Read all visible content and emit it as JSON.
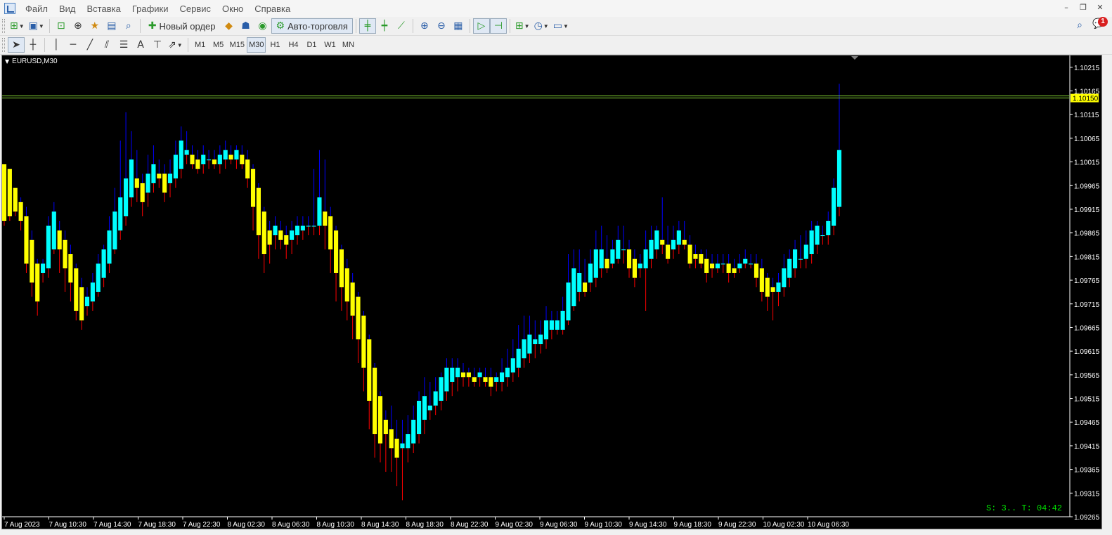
{
  "menu": {
    "items": [
      "Файл",
      "Вид",
      "Вставка",
      "Графики",
      "Сервис",
      "Окно",
      "Справка"
    ]
  },
  "toolbar": {
    "new_order_label": "Новый ордер",
    "auto_trading_label": "Авто-торговля",
    "notification_count": "1"
  },
  "timeframes": [
    "M1",
    "M5",
    "M15",
    "M30",
    "H1",
    "H4",
    "D1",
    "W1",
    "MN"
  ],
  "active_timeframe": "M30",
  "chart": {
    "symbol_label": "EURUSD,M30",
    "status_text": "S: 3.. T: 04:42",
    "bid_label": "1.10150",
    "colors": {
      "bull": "#00ffff",
      "bear": "#ffff00",
      "wick_up": "#0000ff",
      "wick_down": "#ff0000",
      "bid_line": "#7fcc33",
      "bid_box": "#ffff00",
      "status": "#00e000"
    }
  },
  "chart_data": {
    "type": "candlestick-heikin-ashi",
    "symbol": "EURUSD",
    "timeframe": "M30",
    "ylim": [
      1.09265,
      1.1024
    ],
    "y_ticks": [
      "1.10215",
      "1.10165",
      "1.10115",
      "1.10065",
      "1.10015",
      "1.09965",
      "1.09915",
      "1.09865",
      "1.09815",
      "1.09765",
      "1.09715",
      "1.09665",
      "1.09615",
      "1.09565",
      "1.09515",
      "1.09465",
      "1.09415",
      "1.09365",
      "1.09315",
      "1.09265"
    ],
    "x_ticks": [
      "7 Aug 2023",
      "7 Aug 10:30",
      "7 Aug 14:30",
      "7 Aug 18:30",
      "7 Aug 22:30",
      "8 Aug 02:30",
      "8 Aug 06:30",
      "8 Aug 10:30",
      "8 Aug 14:30",
      "8 Aug 18:30",
      "8 Aug 22:30",
      "9 Aug 02:30",
      "9 Aug 06:30",
      "9 Aug 10:30",
      "9 Aug 14:30",
      "9 Aug 18:30",
      "9 Aug 22:30",
      "10 Aug 02:30",
      "10 Aug 06:30"
    ],
    "bid": 1.1015,
    "series": [
      {
        "values": [
          [
            1.1001,
            1.0989,
            1.1001,
            1.0988
          ],
          [
            1.1,
            1.099,
            1.1,
            1.0989
          ],
          [
            1.0996,
            1.0991,
            1.0996,
            1.099
          ],
          [
            1.0993,
            1.0989,
            1.0994,
            1.0987
          ],
          [
            1.099,
            1.098,
            1.0992,
            1.0978
          ],
          [
            1.0985,
            1.0976,
            1.0987,
            1.0973
          ],
          [
            1.098,
            1.0972,
            1.0981,
            1.0969
          ],
          [
            1.0978,
            1.098,
            1.0981,
            1.0976
          ],
          [
            1.0979,
            1.0988,
            1.099,
            1.0977
          ],
          [
            1.0983,
            1.0991,
            1.0993,
            1.0982
          ],
          [
            1.0987,
            1.0983,
            1.0989,
            1.0978
          ],
          [
            1.0985,
            1.0979,
            1.0987,
            1.0974
          ],
          [
            1.0982,
            1.0976,
            1.0984,
            1.0972
          ],
          [
            1.0979,
            1.097,
            1.098,
            1.0968
          ],
          [
            1.0975,
            1.0968,
            1.0977,
            1.0966
          ],
          [
            1.0971,
            1.0973,
            1.0975,
            1.0969
          ],
          [
            1.0972,
            1.0976,
            1.0978,
            1.097
          ],
          [
            1.0974,
            1.098,
            1.0982,
            1.0973
          ],
          [
            1.0977,
            1.0983,
            1.0984,
            1.0975
          ],
          [
            1.098,
            1.0987,
            1.099,
            1.0978
          ],
          [
            1.0983,
            1.0991,
            1.0996,
            1.0982
          ],
          [
            1.0987,
            1.0994,
            1.1006,
            1.0985
          ],
          [
            1.099,
            1.0998,
            1.1012,
            1.0988
          ],
          [
            1.0994,
            1.1002,
            1.1008,
            1.0992
          ],
          [
            1.0998,
            1.0996,
            1.1004,
            1.0993
          ],
          [
            1.0997,
            1.0993,
            1.0999,
            1.099
          ],
          [
            1.0995,
            1.0999,
            1.1003,
            1.0992
          ],
          [
            1.0997,
            1.1001,
            1.1005,
            1.0995
          ],
          [
            1.0999,
            1.0998,
            1.1002,
            1.0996
          ],
          [
            1.0999,
            1.0995,
            1.1001,
            1.0993
          ],
          [
            1.0997,
            1.0999,
            1.1002,
            1.0994
          ],
          [
            1.0998,
            1.1003,
            1.1006,
            1.0996
          ],
          [
            1.1,
            1.1006,
            1.1009,
            1.0998
          ],
          [
            1.1003,
            1.1004,
            1.1008,
            1.1001
          ],
          [
            1.1003,
            1.1001,
            1.1005,
            1.1
          ],
          [
            1.1002,
            1.1,
            1.1004,
            1.0999
          ],
          [
            1.1001,
            1.1003,
            1.1005,
            1.0999
          ],
          [
            1.1002,
            1.1002,
            1.1004,
            1.1
          ],
          [
            1.1002,
            1.1001,
            1.1004,
            1.1
          ],
          [
            1.1001,
            1.1003,
            1.1005,
            1.0999
          ],
          [
            1.1002,
            1.1004,
            1.1006,
            1.1
          ],
          [
            1.1003,
            1.1002,
            1.1005,
            1.1001
          ],
          [
            1.1002,
            1.1004,
            1.1005,
            1.1
          ],
          [
            1.1003,
            1.1001,
            1.1005,
            1.1
          ],
          [
            1.1002,
            1.0998,
            1.1004,
            1.0996
          ],
          [
            1.1,
            1.0992,
            1.1001,
            1.0987
          ],
          [
            1.0996,
            1.0986,
            1.0997,
            1.0981
          ],
          [
            1.0991,
            1.0982,
            1.0992,
            1.0978
          ],
          [
            1.0987,
            1.0984,
            1.0989,
            1.098
          ],
          [
            1.0986,
            1.0988,
            1.099,
            1.0983
          ],
          [
            1.0987,
            1.0985,
            1.0989,
            1.0983
          ],
          [
            1.0986,
            1.0984,
            1.0988,
            1.0981
          ],
          [
            1.0985,
            1.0987,
            1.0989,
            1.0982
          ],
          [
            1.0986,
            1.0988,
            1.099,
            1.0984
          ],
          [
            1.0987,
            1.0988,
            1.099,
            1.0985
          ],
          [
            1.0988,
            1.0988,
            1.099,
            1.0986
          ],
          [
            1.0988,
            1.0988,
            1.1,
            1.0986
          ],
          [
            1.0988,
            1.0994,
            1.1004,
            1.0986
          ],
          [
            1.0991,
            1.0988,
            1.1002,
            1.0983
          ],
          [
            1.099,
            1.0983,
            1.0992,
            1.0978
          ],
          [
            1.0987,
            1.0978,
            1.0988,
            1.0972
          ],
          [
            1.0983,
            1.0975,
            1.0984,
            1.097
          ],
          [
            1.0979,
            1.0972,
            1.0981,
            1.0968
          ],
          [
            1.0976,
            1.0969,
            1.0978,
            1.0964
          ],
          [
            1.0973,
            1.0964,
            1.0974,
            1.0959
          ],
          [
            1.0969,
            1.0958,
            1.097,
            1.0953
          ],
          [
            1.0964,
            1.0951,
            1.0965,
            1.0945
          ],
          [
            1.0958,
            1.0944,
            1.0959,
            1.0939
          ],
          [
            1.0952,
            1.0942,
            1.0953,
            1.0938
          ],
          [
            1.0947,
            1.0944,
            1.0949,
            1.0936
          ],
          [
            1.0945,
            1.0941,
            1.095,
            1.0936
          ],
          [
            1.0943,
            1.0939,
            1.0947,
            1.0933
          ],
          [
            1.0941,
            1.0942,
            1.0947,
            1.093
          ],
          [
            1.0941,
            1.0944,
            1.0948,
            1.0938
          ],
          [
            1.0942,
            1.0947,
            1.095,
            1.094
          ],
          [
            1.0944,
            1.0951,
            1.0953,
            1.0942
          ],
          [
            1.0947,
            1.0952,
            1.0956,
            1.0944
          ],
          [
            1.0949,
            1.095,
            1.0955,
            1.0947
          ],
          [
            1.095,
            1.0953,
            1.0956,
            1.0948
          ],
          [
            1.0951,
            1.0956,
            1.0957,
            1.0949
          ],
          [
            1.0953,
            1.0958,
            1.096,
            1.0951
          ],
          [
            1.0955,
            1.0958,
            1.096,
            1.0952
          ],
          [
            1.0956,
            1.0958,
            1.096,
            1.0953
          ],
          [
            1.0957,
            1.0956,
            1.0959,
            1.0954
          ],
          [
            1.0957,
            1.0956,
            1.0958,
            1.0954
          ],
          [
            1.0956,
            1.0955,
            1.0958,
            1.0954
          ],
          [
            1.0956,
            1.0957,
            1.0958,
            1.0954
          ],
          [
            1.0956,
            1.0955,
            1.0958,
            1.0954
          ],
          [
            1.0956,
            1.0954,
            1.0958,
            1.0952
          ],
          [
            1.0955,
            1.0956,
            1.0957,
            1.0953
          ],
          [
            1.0955,
            1.0957,
            1.096,
            1.0953
          ],
          [
            1.0956,
            1.0958,
            1.0962,
            1.0954
          ],
          [
            1.0957,
            1.096,
            1.0964,
            1.0955
          ],
          [
            1.0958,
            1.0962,
            1.0967,
            1.0956
          ],
          [
            1.096,
            1.0964,
            1.0969,
            1.0958
          ],
          [
            1.0961,
            1.0965,
            1.0969,
            1.0959
          ],
          [
            1.0963,
            1.0964,
            1.0968,
            1.096
          ],
          [
            1.0963,
            1.0965,
            1.0968,
            1.0961
          ],
          [
            1.0964,
            1.0968,
            1.0971,
            1.0962
          ],
          [
            1.0966,
            1.0968,
            1.097,
            1.0964
          ],
          [
            1.0966,
            1.0968,
            1.097,
            1.0965
          ],
          [
            1.0966,
            1.097,
            1.0973,
            1.0965
          ],
          [
            1.0968,
            1.0976,
            1.0982,
            1.0967
          ],
          [
            1.0971,
            1.0979,
            1.0983,
            1.097
          ],
          [
            1.0974,
            1.0978,
            1.0983,
            1.0972
          ],
          [
            1.0976,
            1.0974,
            1.0981,
            1.0973
          ],
          [
            1.0976,
            1.098,
            1.0983,
            1.0974
          ],
          [
            1.0977,
            1.0983,
            1.0987,
            1.0975
          ],
          [
            1.0979,
            1.0983,
            1.0988,
            1.0977
          ],
          [
            1.0981,
            1.0979,
            1.0986,
            1.0978
          ],
          [
            1.098,
            1.0983,
            1.0985,
            1.0979
          ],
          [
            1.0981,
            1.0985,
            1.0988,
            1.098
          ],
          [
            1.0983,
            1.0983,
            1.0988,
            1.098
          ],
          [
            1.0983,
            1.0979,
            1.0985,
            1.0977
          ],
          [
            1.0981,
            1.0977,
            1.0983,
            1.0975
          ],
          [
            1.0979,
            1.098,
            1.0982,
            1.0977
          ],
          [
            1.0979,
            1.0983,
            1.0987,
            1.097
          ],
          [
            1.0981,
            1.0985,
            1.0988,
            1.0979
          ],
          [
            1.0983,
            1.0987,
            1.0988,
            1.0981
          ],
          [
            1.0985,
            1.0984,
            1.0994,
            1.0982
          ],
          [
            1.0984,
            1.0981,
            1.0988,
            1.098
          ],
          [
            1.0983,
            1.0985,
            1.0988,
            1.0981
          ],
          [
            1.0984,
            1.0987,
            1.0989,
            1.0982
          ],
          [
            1.0985,
            1.0984,
            1.0989,
            1.0983
          ],
          [
            1.0984,
            1.098,
            1.0986,
            1.0979
          ],
          [
            1.0982,
            1.0981,
            1.0984,
            1.0979
          ],
          [
            1.0982,
            1.098,
            1.0983,
            1.0979
          ],
          [
            1.0981,
            1.0978,
            1.0983,
            1.0976
          ],
          [
            1.098,
            1.0979,
            1.0982,
            1.0977
          ],
          [
            1.0979,
            1.098,
            1.0982,
            1.0978
          ],
          [
            1.098,
            1.098,
            1.0982,
            1.0978
          ],
          [
            1.098,
            1.0978,
            1.0982,
            1.0976
          ],
          [
            1.0979,
            1.0978,
            1.0981,
            1.0977
          ],
          [
            1.0979,
            1.098,
            1.0982,
            1.0978
          ],
          [
            1.098,
            1.0981,
            1.0983,
            1.0979
          ],
          [
            1.098,
            1.098,
            1.0982,
            1.0979
          ],
          [
            1.098,
            1.0977,
            1.0982,
            1.0975
          ],
          [
            1.0979,
            1.0974,
            1.0981,
            1.0972
          ],
          [
            1.0977,
            1.0973,
            1.0978,
            1.097
          ],
          [
            1.0975,
            1.0974,
            1.0977,
            1.0968
          ],
          [
            1.0974,
            1.0976,
            1.0978,
            1.0971
          ],
          [
            1.0975,
            1.0979,
            1.0982,
            1.0973
          ],
          [
            1.0977,
            1.0981,
            1.0983,
            1.0975
          ],
          [
            1.0979,
            1.0983,
            1.0985,
            1.0977
          ],
          [
            1.0981,
            1.0981,
            1.0986,
            1.0979
          ],
          [
            1.0981,
            1.0984,
            1.0987,
            1.0979
          ],
          [
            1.0982,
            1.0987,
            1.0989,
            1.098
          ],
          [
            1.0984,
            1.0988,
            1.0989,
            1.0982
          ],
          [
            1.0986,
            1.0986,
            1.0988,
            1.0984
          ],
          [
            1.0986,
            1.0989,
            1.0991,
            1.0984
          ],
          [
            1.0988,
            1.0996,
            1.0998,
            1.0986
          ],
          [
            1.0992,
            1.1004,
            1.1018,
            1.099
          ]
        ]
      }
    ]
  }
}
